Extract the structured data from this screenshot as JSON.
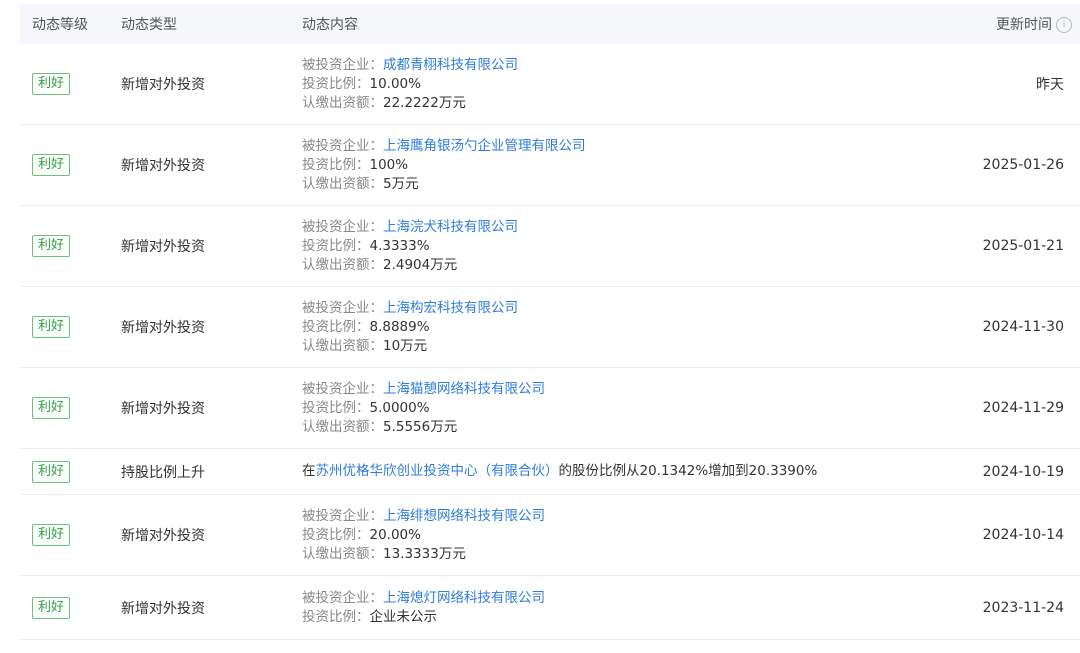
{
  "header": {
    "level": "动态等级",
    "type": "动态类型",
    "content": "动态内容",
    "time": "更新时间",
    "info_icon": "i"
  },
  "labels": {
    "company": "被投资企业：",
    "ratio": "投资比例：",
    "amount": "认缴出资额："
  },
  "rows": [
    {
      "badge": "利好",
      "type": "新增对外投资",
      "company": "成都青栩科技有限公司",
      "ratio": "10.00%",
      "amount": "22.2222万元",
      "date": "昨天"
    },
    {
      "badge": "利好",
      "type": "新增对外投资",
      "company": "上海鹰角银汤勺企业管理有限公司",
      "ratio": "100%",
      "amount": "5万元",
      "date": "2025-01-26"
    },
    {
      "badge": "利好",
      "type": "新增对外投资",
      "company": "上海浣犬科技有限公司",
      "ratio": "4.3333%",
      "amount": "2.4904万元",
      "date": "2025-01-21"
    },
    {
      "badge": "利好",
      "type": "新增对外投资",
      "company": "上海构宏科技有限公司",
      "ratio": "8.8889%",
      "amount": "10万元",
      "date": "2024-11-30"
    },
    {
      "badge": "利好",
      "type": "新增对外投资",
      "company": "上海猫憩网络科技有限公司",
      "ratio": "5.0000%",
      "amount": "5.5556万元",
      "date": "2024-11-29"
    },
    {
      "badge": "利好",
      "type": "持股比例上升",
      "pre": "在",
      "company": "苏州优格华欣创业投资中心（有限合伙）",
      "post": "的股份比例从20.1342%增加到20.3390%",
      "date": "2024-10-19"
    },
    {
      "badge": "利好",
      "type": "新增对外投资",
      "company": "上海绯想网络科技有限公司",
      "ratio": "20.00%",
      "amount": "13.3333万元",
      "date": "2024-10-14"
    },
    {
      "badge": "利好",
      "type": "新增对外投资",
      "company": "上海熄灯网络科技有限公司",
      "ratio": "企业未公示",
      "date": "2023-11-24"
    }
  ]
}
